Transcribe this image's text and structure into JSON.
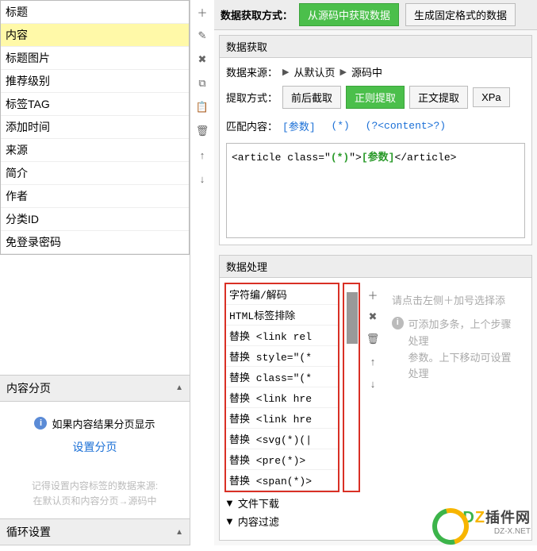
{
  "left": {
    "fields": [
      "标题",
      "内容",
      "标题图片",
      "推荐级别",
      "标签TAG",
      "添加时间",
      "来源",
      "简介",
      "作者",
      "分类ID",
      "免登录密码"
    ],
    "selected_index": 1,
    "section_pagination": "内容分页",
    "pagination_hint": "如果内容结果分页显示",
    "pagination_link": "设置分页",
    "source_hint_l1": "记得设置内容标签的数据来源:",
    "source_hint_l2": "在默认页和内容分页→源码中",
    "section_loop": "循环设置"
  },
  "top": {
    "method_label": "数据获取方式：",
    "btn_from_source": "从源码中获取数据",
    "btn_fixed_format": "生成固定格式的数据"
  },
  "acquire": {
    "title": "数据获取",
    "source_label": "数据来源：",
    "source_opt1": "从默认页",
    "source_opt2": "源码中",
    "extract_label": "提取方式：",
    "btn_fb": "前后截取",
    "btn_regex": "正则提取",
    "btn_body": "正文提取",
    "btn_xpath": "XPa",
    "match_label": "匹配内容：",
    "match_token1": "[参数]",
    "match_token2": "(*)",
    "match_token3": "(?<content>?)",
    "code_prefix": "<article class=\"",
    "code_mid": "(*)",
    "code_close": "\">",
    "code_param": "[参数]",
    "code_suffix": "</article>"
  },
  "process": {
    "title": "数据处理",
    "items": [
      "字符编/解码",
      "HTML标签排除",
      "替换 <link rel",
      "替换 style=\"(*",
      "替换 class=\"(*",
      "替换 <link hre",
      "替换 <link hre",
      "替换 <svg(*)(|",
      "替换 <pre(*)>",
      "替换 <span(*)>"
    ],
    "extra1_icon": "▼",
    "extra1": "文件下载",
    "extra2_icon": "▼",
    "extra2": "内容过滤",
    "hint1": "请点击左侧＋加号选择添",
    "hint2": "可添加多条，上个步骤处理",
    "hint3": "参数。上下移动可设置处理"
  },
  "watermark": {
    "brand": "DZ插件网",
    "sub": "DZ-X.NET"
  }
}
